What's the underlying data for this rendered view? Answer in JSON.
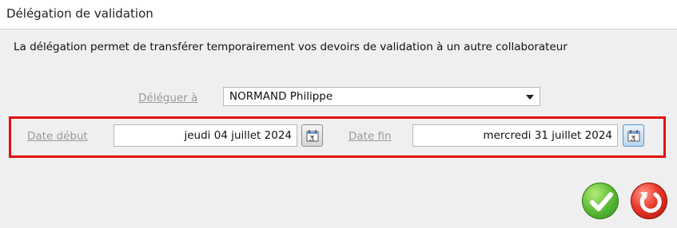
{
  "window": {
    "title": "Délégation de validation"
  },
  "description": "La délégation permet de transférer temporairement vos devoirs de validation à un autre collaborateur",
  "delegate": {
    "label": "Déléguer à",
    "value": "NORMAND Philippe"
  },
  "dates": {
    "start_label": "Date début",
    "start_value": "jeudi 04 juillet 2024",
    "end_label": "Date fin",
    "end_value": "mercredi 31 juillet 2024"
  },
  "colors": {
    "highlight": "#e01010",
    "ok": "#63c13a",
    "cancel": "#e8382a"
  },
  "icons": {
    "calendar": "calendar-icon",
    "ok": "checkmark-icon",
    "cancel": "undo-arrow-icon"
  }
}
